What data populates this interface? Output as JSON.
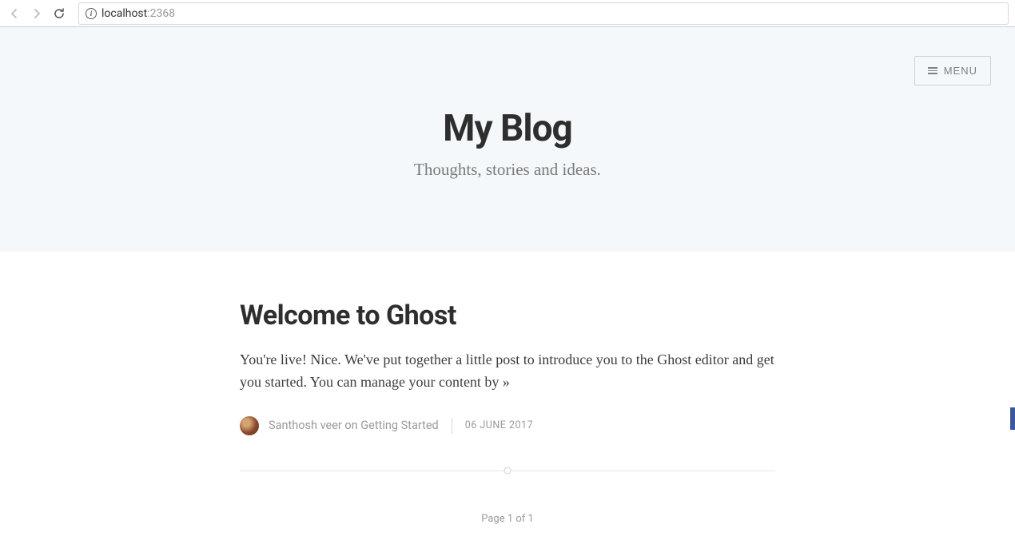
{
  "browser": {
    "url_host": "localhost",
    "url_port": ":2368",
    "info_glyph": "i"
  },
  "menu": {
    "label": "MENU"
  },
  "hero": {
    "title": "My Blog",
    "subtitle": "Thoughts, stories and ideas."
  },
  "post": {
    "title": "Welcome to Ghost",
    "excerpt": "You're live! Nice. We've put together a little post to introduce you to the Ghost editor and get you started. You can manage your content by »",
    "author": "Santhosh veer",
    "on_word": " on ",
    "tag": "Getting Started",
    "date": "06 JUNE 2017"
  },
  "pagination": {
    "text": "Page 1 of 1"
  }
}
